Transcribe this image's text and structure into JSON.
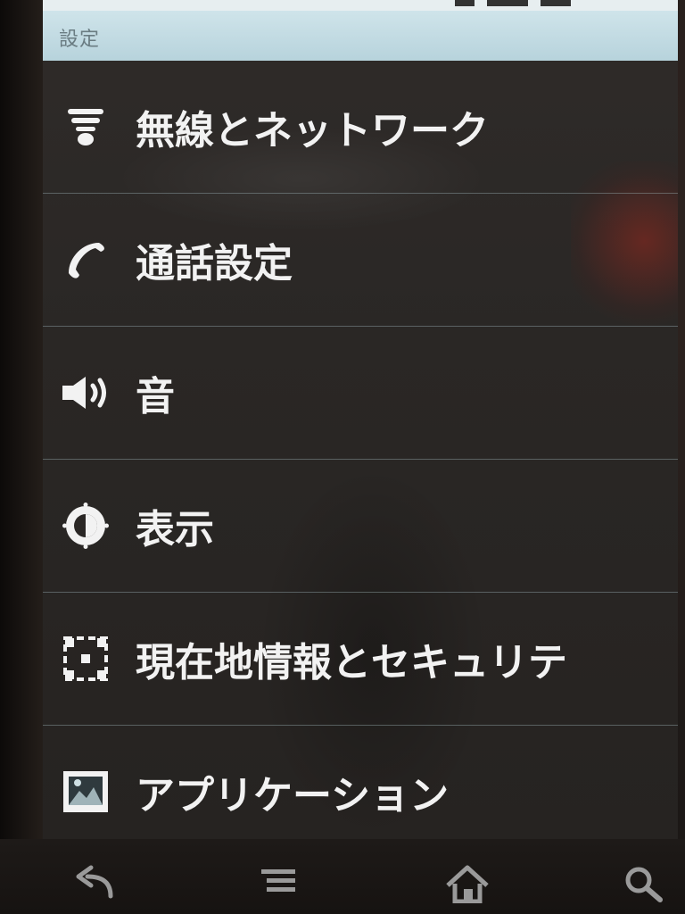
{
  "app": {
    "title": "設定"
  },
  "menu": {
    "items": [
      {
        "label": "無線とネットワーク",
        "icon": "wifi-icon"
      },
      {
        "label": "通話設定",
        "icon": "phone-icon"
      },
      {
        "label": "音",
        "icon": "speaker-icon"
      },
      {
        "label": "表示",
        "icon": "display-brightness-icon"
      },
      {
        "label": "現在地情報とセキュリテ",
        "icon": "location-security-icon"
      },
      {
        "label": "アプリケーション",
        "icon": "applications-icon"
      }
    ]
  },
  "navigation": {
    "buttons": [
      {
        "icon": "back-icon"
      },
      {
        "icon": "menu-icon"
      },
      {
        "icon": "home-icon"
      },
      {
        "icon": "search-icon"
      }
    ]
  },
  "colors": {
    "title_bar": "#b7d3dc",
    "title_text": "#6a7c82",
    "row_text": "#f2f2f2",
    "divider": "#96aaaf",
    "screen_bg": "#2a2725"
  }
}
